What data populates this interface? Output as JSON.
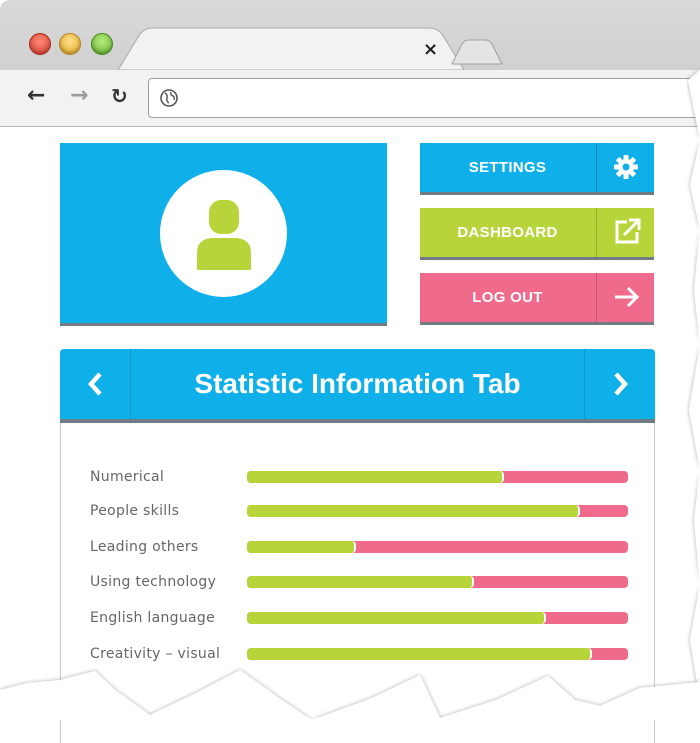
{
  "browser": {
    "tab_close": "×",
    "icons": {
      "back": "arrow-left-icon",
      "forward": "arrow-right-icon",
      "reload": "reload-icon",
      "site": "globe-icon"
    }
  },
  "profile": {
    "icon": "user-icon"
  },
  "actions": {
    "settings_label": "SETTINGS",
    "dashboard_label": "DASHBOARD",
    "logout_label": "LOG OUT"
  },
  "stats": {
    "title": "Statistic Information Tab",
    "items": [
      {
        "label": "Numerical",
        "value": 0.67
      },
      {
        "label": "People skills",
        "value": 0.87
      },
      {
        "label": "Leading others",
        "value": 0.28
      },
      {
        "label": "Using technology",
        "value": 0.59
      },
      {
        "label": "English language",
        "value": 0.78
      },
      {
        "label": "Creativity – visual",
        "value": 0.9
      }
    ]
  },
  "colors": {
    "blue": "#0fb0ea",
    "green": "#b7d43a",
    "pink": "#f06a8b"
  }
}
